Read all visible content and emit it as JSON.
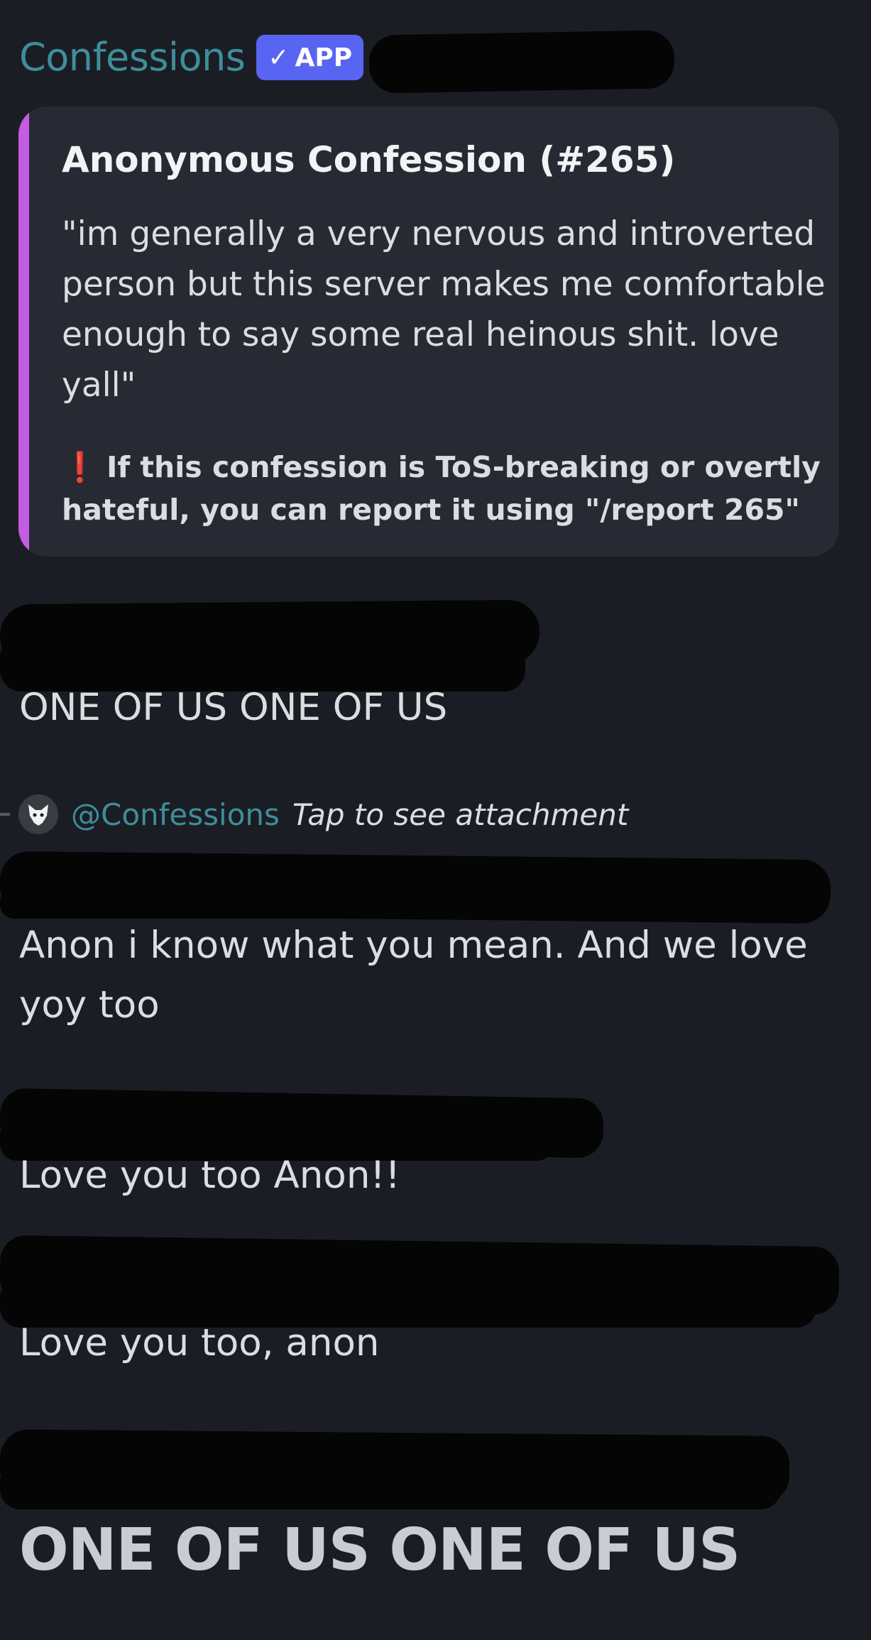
{
  "author": {
    "name": "Confessions",
    "badge": "APP",
    "badge_icon": "check-icon"
  },
  "embed": {
    "title": "Anonymous Confession (#265)",
    "body": "\"im generally a very nervous and introverted person but this server makes me comfortable enough to say some real heinous shit. love yall\"",
    "note_icon": "exclamation-icon",
    "note": "If this confession is ToS-breaking or overtly hateful, you can report it using \"/report 265\"",
    "accent_color": "#c25ce0"
  },
  "messages": [
    {
      "text": "ONE OF US ONE OF US"
    },
    {
      "text": "Anon i know what you mean. And we love yoy too"
    },
    {
      "text": "Love you too Anon!!"
    },
    {
      "text": "Love you too, anon"
    },
    {
      "text": "ONE OF US ONE OF US"
    }
  ],
  "reply": {
    "mention": "@Confessions",
    "text": "Tap to see attachment"
  },
  "colors": {
    "background": "#1b1d24",
    "embed_background": "#272a33",
    "badge": "#5865f2",
    "author_name": "#3e8e9a",
    "warning": "#e23f3f"
  }
}
